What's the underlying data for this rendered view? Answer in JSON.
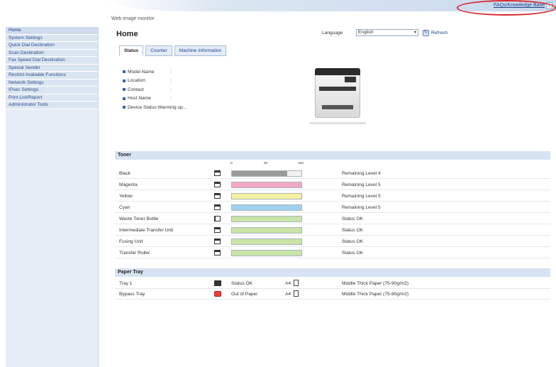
{
  "header": {
    "app_name": "Web image monitor",
    "faq_link": "FAQs/Knowledge Base",
    "faq_info_icon": "i"
  },
  "sidebar": {
    "items": [
      {
        "label": "Home"
      },
      {
        "label": "System Settings"
      },
      {
        "label": "Quick Dial Destination"
      },
      {
        "label": "Scan Destination"
      },
      {
        "label": "Fax Speed Dial Destination"
      },
      {
        "label": "Special Sender"
      },
      {
        "label": "Restrict Available Functions"
      },
      {
        "label": "Network Settings"
      },
      {
        "label": "IPsec Settings"
      },
      {
        "label": "Print List/Report"
      },
      {
        "label": "Administrator Tools"
      }
    ]
  },
  "main": {
    "title": "Home",
    "language_label": "Language",
    "language_value": "English",
    "refresh_label": "Refresh",
    "tabs": [
      {
        "label": "Status"
      },
      {
        "label": "Counter"
      },
      {
        "label": "Machine Information"
      }
    ],
    "device_info": [
      {
        "label": "Model Name",
        "sep": ":",
        "value": ""
      },
      {
        "label": "Location",
        "sep": ":",
        "value": ""
      },
      {
        "label": "Contact",
        "sep": ":",
        "value": ""
      },
      {
        "label": "Host Name",
        "sep": ":",
        "value": ""
      },
      {
        "label": "Device Status",
        "sep": ":",
        "value": "Warming up..."
      }
    ]
  },
  "toner": {
    "section_title": "Toner",
    "scale_labels": [
      "0",
      "50",
      "100"
    ],
    "items": [
      {
        "name": "Black",
        "level": 0.8,
        "color": "#9a9a9a",
        "status": "Remaining Level 4",
        "icon": "toner-cartridge-icon"
      },
      {
        "name": "Magenta",
        "level": 1.0,
        "color": "#f3a9c3",
        "status": "Remaining Level 5",
        "icon": "toner-cartridge-icon"
      },
      {
        "name": "Yellow",
        "level": 1.0,
        "color": "#f6f0a2",
        "status": "Remaining Level 5",
        "icon": "toner-cartridge-icon"
      },
      {
        "name": "Cyan",
        "level": 1.0,
        "color": "#9fd0ef",
        "status": "Remaining Level 5",
        "icon": "toner-cartridge-icon"
      },
      {
        "name": "Waste Toner Bottle",
        "level": 1.0,
        "color": "#c9e4a6",
        "status": "Status OK",
        "icon": "waste-bottle-icon"
      },
      {
        "name": "Intermediate Transfer Unit",
        "level": 1.0,
        "color": "#c9e4a6",
        "status": "Status OK",
        "icon": "unit-icon"
      },
      {
        "name": "Fusing Unit",
        "level": 1.0,
        "color": "#c9e4a6",
        "status": "Status OK",
        "icon": "unit-icon"
      },
      {
        "name": "Transfer Roller",
        "level": 1.0,
        "color": "#c9e4a6",
        "status": "Status OK",
        "icon": "unit-icon"
      }
    ]
  },
  "paper_tray": {
    "section_title": "Paper Tray",
    "items": [
      {
        "name": "Tray 1",
        "status": "Status OK",
        "size": "A4",
        "paper_type": "Middle Thick Paper (75-90g/m2)",
        "error": false
      },
      {
        "name": "Bypass Tray",
        "status": "Out of Paper",
        "size": "A4",
        "paper_type": "Middle Thick Paper (75-90g/m2)",
        "error": true
      }
    ]
  },
  "colors": {
    "accent": "#1e3f8c",
    "section_bg": "#d6e3f2",
    "sidebar_bg": "#e6edf6",
    "highlight_oval": "#d8262b"
  }
}
